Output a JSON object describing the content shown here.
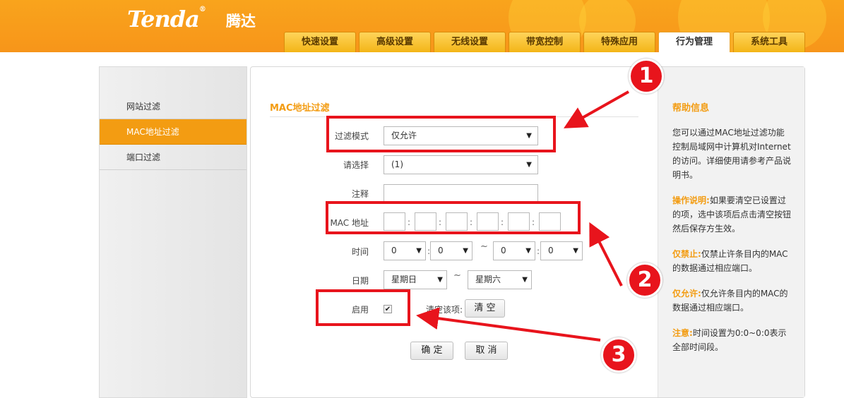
{
  "header": {
    "logo": "Tenda",
    "logo_reg": "®",
    "logo_cn": "腾达",
    "tabs": [
      "快速设置",
      "高级设置",
      "无线设置",
      "带宽控制",
      "特殊应用",
      "行为管理",
      "系统工具"
    ],
    "active_tab": "行为管理"
  },
  "sidebar": {
    "items": [
      "网站过滤",
      "MAC地址过滤",
      "端口过滤"
    ],
    "active": "MAC地址过滤"
  },
  "form": {
    "section_title": "MAC地址过滤",
    "filter_mode_label": "过滤模式",
    "filter_mode_value": "仅允许",
    "select_label": "请选择",
    "select_value": "(1)",
    "note_label": "注释",
    "note_value": "",
    "mac_label": "MAC 地址",
    "mac_colon": ":",
    "time_label": "时间",
    "time_values": [
      "0",
      "0",
      "0",
      "0"
    ],
    "tilde": "~",
    "date_label": "日期",
    "date_from": "星期日",
    "date_to": "星期六",
    "enable_label": "启用",
    "enable_checked": true,
    "clear_label": "清空该项:",
    "clear_button": "清 空",
    "ok_button": "确 定",
    "cancel_button": "取 消"
  },
  "help": {
    "title": "帮助信息",
    "intro": "您可以通过MAC地址过滤功能控制局域网中计算机对Internet的访问。详细使用请参考产品说明书。",
    "op_label": "操作说明:",
    "op_text": "如果要清空已设置过的项，选中该项后点击清空按钮然后保存方生效。",
    "deny_label": "仅禁止:",
    "deny_text": "仅禁止许条目内的MAC的数据通过相应端口。",
    "allow_label": "仅允许:",
    "allow_text": "仅允许条目内的MAC的数据通过相应端口。",
    "note_label": "注意:",
    "note_text": "时间设置为0:0~0:0表示全部时间段。"
  },
  "annotations": {
    "markers": [
      "1",
      "2",
      "3"
    ],
    "color": "#e8141c"
  },
  "colors": {
    "header": "#f7951a",
    "accent": "#f39c12"
  }
}
